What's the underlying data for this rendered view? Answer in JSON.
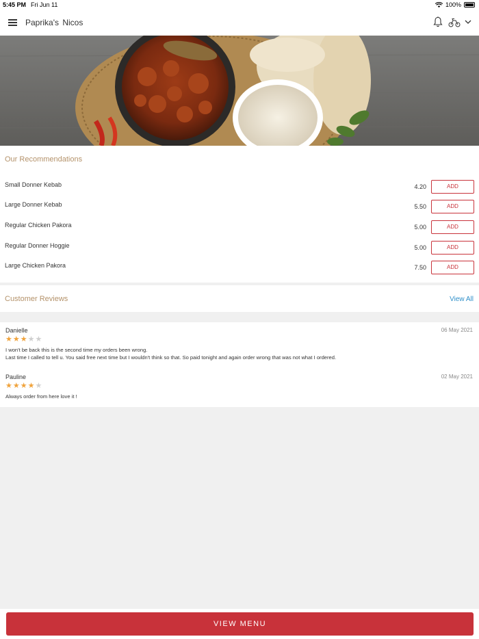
{
  "status_bar": {
    "time": "5:45 PM",
    "date": "Fri Jun 11",
    "battery": "100%"
  },
  "header": {
    "title": "Paprika's  Nicos",
    "icons": [
      "menu-icon",
      "bell-icon",
      "scooter-icon",
      "chevron-down-icon"
    ]
  },
  "hero": {
    "icon": "curry-photo"
  },
  "recommendations": {
    "title": "Our Recommendations",
    "add_label": "ADD",
    "items": [
      {
        "name": "Small Donner Kebab",
        "price": "4.20"
      },
      {
        "name": "Large Donner Kebab",
        "price": "5.50"
      },
      {
        "name": "Regular Chicken Pakora",
        "price": "5.00"
      },
      {
        "name": "Regular Donner Hoggie",
        "price": "5.00"
      },
      {
        "name": "Large Chicken Pakora",
        "price": "7.50"
      }
    ]
  },
  "reviews": {
    "title": "Customer Reviews",
    "view_all": "View All",
    "items": [
      {
        "name": "Danielle",
        "date": "06 May 2021",
        "rating": 3,
        "text": "I won't be back this is the second time my orders been wrong.\nLast time I called to tell u. You said free next time but I wouldn't think so that. So paid tonight and again order wrong that was not what I ordered."
      },
      {
        "name": "Pauline",
        "date": "02 May 2021",
        "rating": 4,
        "text": "Always order from here    love it !"
      }
    ]
  },
  "footer": {
    "view_menu_label": "VIEW MENU"
  },
  "colors": {
    "accent": "#c8323a",
    "section_title": "#b4926a",
    "link": "#2f8fc9",
    "star_on": "#f0a33c"
  }
}
